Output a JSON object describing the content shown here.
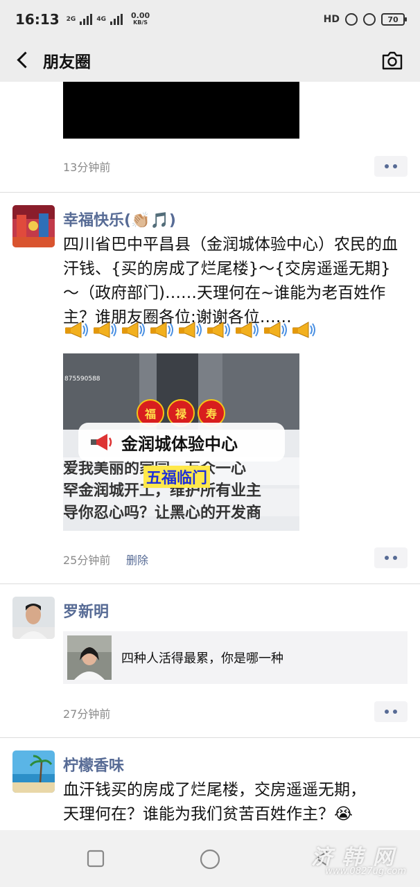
{
  "status_bar": {
    "time": "16:13",
    "network_1": "2G",
    "network_2": "4G",
    "speed_value": "0.00",
    "speed_unit": "KB/S",
    "hd_label": "HD",
    "battery": "70"
  },
  "nav": {
    "title": "朋友圈"
  },
  "posts": [
    {
      "time": "13分钟前"
    },
    {
      "username": "幸福快乐(👏🏼🎵)",
      "text": "四川省巴中平昌县（金润城体验中心）农民的血汗钱、{买的房成了烂尾楼}～{交房遥遥无期}～（政府部门)……天理何在~谁能为老百姓作主？谁朋友圈各位:谢谢各位……",
      "emoji_count": 9,
      "video": {
        "phone_number": "875590588",
        "lanterns": [
          "福",
          "禄",
          "寿"
        ],
        "banner_title": "金润城体验中心",
        "caption": "五福临门",
        "sign_line_1": "爱我美丽的家园，万众一心",
        "sign_line_2": "罕金润城开工，维护所有业主",
        "sign_line_3": "导你忍心吗？让黑心的开发商"
      },
      "time": "25分钟前",
      "delete_label": "删除"
    },
    {
      "username": "罗新明",
      "link_title": "四种人活得最累，你是哪一种",
      "time": "27分钟前"
    },
    {
      "username": "柠檬香味",
      "text": "血汗钱买的房成了烂尾楼，交房遥遥无期，天理何在？谁能为我们贫苦百姓作主？😭😭😭😭"
    }
  ],
  "watermark": {
    "text": "济 韩 网",
    "sub": "www.0827ug.com"
  }
}
